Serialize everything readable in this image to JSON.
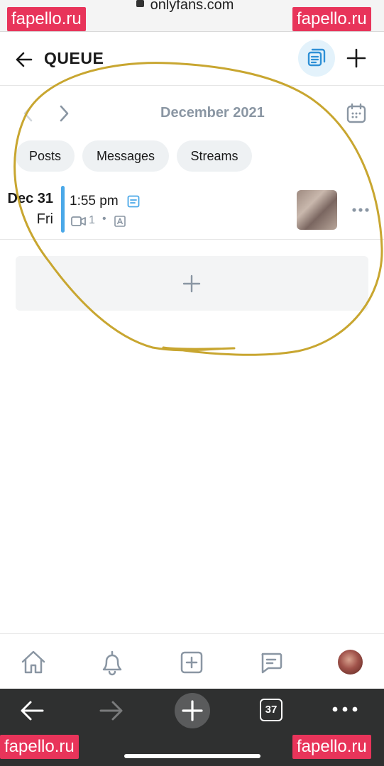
{
  "browser": {
    "url": "onlyfans.com",
    "tab_count": "37"
  },
  "watermarks": {
    "top_left": "fapello.ru",
    "top_right": "fapello.ru",
    "bottom_left": "fapello.ru",
    "bottom_right": "fapello.ru"
  },
  "header": {
    "title": "QUEUE"
  },
  "calendar": {
    "month_label": "December 2021"
  },
  "filters": [
    {
      "label": "Posts"
    },
    {
      "label": "Messages"
    },
    {
      "label": "Streams"
    }
  ],
  "queue_items": [
    {
      "date": "Dec 31",
      "day": "Fri",
      "time": "1:55 pm",
      "media_count": "1",
      "separator": "•"
    }
  ],
  "colors": {
    "accent": "#4aa8e8",
    "muted_text": "#8a96a3",
    "annotation": "#c8a630",
    "watermark": "#e8345a"
  },
  "icons": {
    "header": [
      "back-arrow-icon",
      "queue-list-icon",
      "plus-icon"
    ],
    "month_nav": [
      "chevron-left-icon",
      "chevron-right-icon",
      "calendar-icon"
    ],
    "item": [
      "note-icon",
      "video-icon",
      "auto-text-icon",
      "more-dots-icon"
    ],
    "bottom_nav": [
      "home-icon",
      "bell-icon",
      "add-square-icon",
      "chat-icon",
      "avatar"
    ],
    "browser": [
      "back-arrow-icon",
      "forward-arrow-icon",
      "plus-icon",
      "tabs-icon",
      "menu-dots-icon"
    ]
  }
}
